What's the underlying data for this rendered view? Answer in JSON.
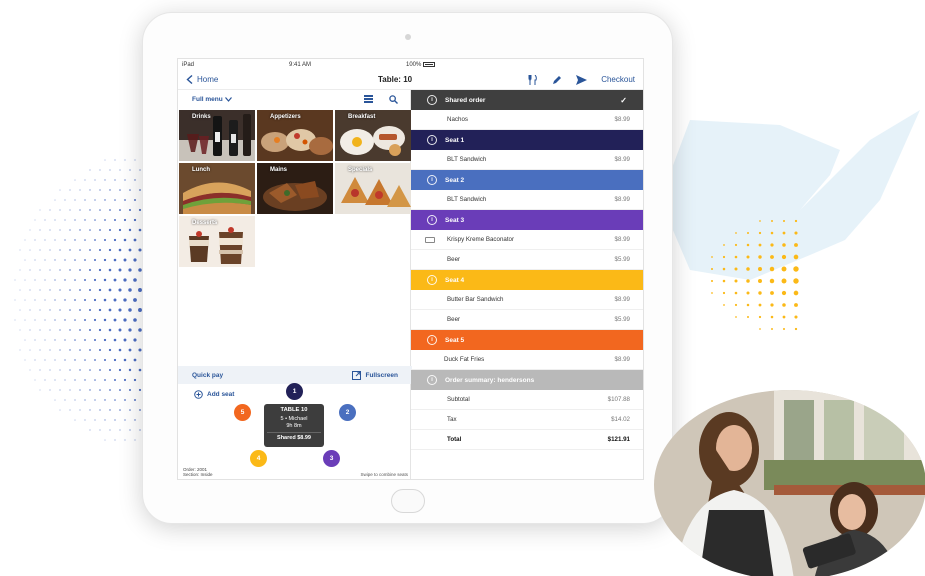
{
  "statusbar": {
    "device": "iPad",
    "time": "9:41 AM",
    "battery": "100%"
  },
  "navbar": {
    "back_label": "Home",
    "title": "Table: 10",
    "checkout_label": "Checkout"
  },
  "menu": {
    "selector_label": "Full menu"
  },
  "categories": [
    {
      "label": "Drinks"
    },
    {
      "label": "Appetizers"
    },
    {
      "label": "Breakfast"
    },
    {
      "label": "Lunch"
    },
    {
      "label": "Mains"
    },
    {
      "label": "Specials"
    },
    {
      "label": "Desserts"
    }
  ],
  "quickpay": {
    "label": "Quick pay",
    "fullscreen_label": "Fullscreen"
  },
  "seating": {
    "add_seat_label": "Add seat",
    "seats": [
      "1",
      "2",
      "3",
      "4",
      "5"
    ],
    "table_card": {
      "name": "TABLE 10",
      "line1": "5 • Michael",
      "line2": "9h 8m",
      "shared": "Shared $8.99"
    },
    "order_info_line1": "Order: 2001",
    "order_info_line2": "Section: Inside",
    "swipe_hint": "Swipe to combine seats"
  },
  "order": {
    "shared": {
      "label": "Shared order",
      "items": [
        {
          "name": "Nachos",
          "price": "$8.99"
        }
      ]
    },
    "seat1": {
      "label": "Seat 1",
      "items": [
        {
          "name": "BLT Sandwich",
          "price": "$8.99"
        }
      ]
    },
    "seat2": {
      "label": "Seat 2",
      "items": [
        {
          "name": "BLT Sandwich",
          "price": "$8.99"
        }
      ]
    },
    "seat3": {
      "label": "Seat 3",
      "items": [
        {
          "name": "Krispy Kreme Baconator",
          "price": "$8.99"
        },
        {
          "name": "Beer",
          "price": "$5.99"
        }
      ]
    },
    "seat4": {
      "label": "Seat 4",
      "items": [
        {
          "name": "Butter Bar Sandwich",
          "price": "$8.99"
        },
        {
          "name": "Beer",
          "price": "$5.99"
        }
      ]
    },
    "seat5": {
      "label": "Seat 5",
      "items": [
        {
          "name": "Duck Fat Fries",
          "price": "$8.99"
        }
      ]
    },
    "summary": {
      "label": "Order summary: hendersons",
      "subtotal_label": "Subtotal",
      "subtotal": "$107.88",
      "tax_label": "Tax",
      "tax": "$14.02",
      "total_label": "Total",
      "total": "$121.91"
    }
  },
  "colors": {
    "brand_blue": "#2a5599",
    "shared_header": "#3f3f3f",
    "seat1": "#222158",
    "seat2": "#4a6fbf",
    "seat3": "#6a3db8",
    "seat4": "#fbb917",
    "seat5": "#f2671f",
    "summary_header": "#b9b9b9"
  }
}
